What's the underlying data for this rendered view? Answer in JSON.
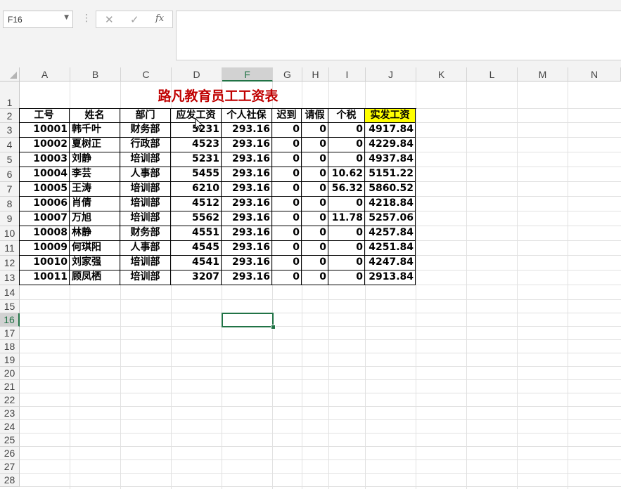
{
  "name_box": {
    "value": "F16"
  },
  "formula_bar": {
    "cancel_icon": "✕",
    "enter_icon": "✓",
    "fx_label": "fx",
    "content": ""
  },
  "columns": [
    "A",
    "B",
    "C",
    "D",
    "F",
    "G",
    "H",
    "I",
    "J",
    "K",
    "L",
    "M",
    "N"
  ],
  "active_column": "F",
  "rows": [
    "1",
    "2",
    "3",
    "4",
    "5",
    "6",
    "7",
    "8",
    "9",
    "10",
    "11",
    "12",
    "13",
    "14",
    "15",
    "16",
    "17",
    "18",
    "19",
    "20",
    "21",
    "22",
    "23",
    "24",
    "25",
    "26",
    "27",
    "28"
  ],
  "active_row": "16",
  "sheet": {
    "title": "路凡教育员工工资表",
    "headers": [
      "工号",
      "姓名",
      "部门",
      "应发工资",
      "个人社保",
      "迟到",
      "请假",
      "个税",
      "实发工资"
    ],
    "highlight_header_color": "#ffff00",
    "title_color": "#c00000",
    "data": [
      [
        "10001",
        "韩千叶",
        "财务部",
        "5231",
        "293.16",
        "0",
        "0",
        "0",
        "4917.84"
      ],
      [
        "10002",
        "夏树正",
        "行政部",
        "4523",
        "293.16",
        "0",
        "0",
        "0",
        "4229.84"
      ],
      [
        "10003",
        "刘静",
        "培训部",
        "5231",
        "293.16",
        "0",
        "0",
        "0",
        "4937.84"
      ],
      [
        "10004",
        "李芸",
        "人事部",
        "5455",
        "293.16",
        "0",
        "0",
        "10.62",
        "5151.22"
      ],
      [
        "10005",
        "王涛",
        "培训部",
        "6210",
        "293.16",
        "0",
        "0",
        "56.32",
        "5860.52"
      ],
      [
        "10006",
        "肖倩",
        "培训部",
        "4512",
        "293.16",
        "0",
        "0",
        "0",
        "4218.84"
      ],
      [
        "10007",
        "万旭",
        "培训部",
        "5562",
        "293.16",
        "0",
        "0",
        "11.78",
        "5257.06"
      ],
      [
        "10008",
        "林静",
        "财务部",
        "4551",
        "293.16",
        "0",
        "0",
        "0",
        "4257.84"
      ],
      [
        "10009",
        "何琪阳",
        "人事部",
        "4545",
        "293.16",
        "0",
        "0",
        "0",
        "4251.84"
      ],
      [
        "10010",
        "刘家强",
        "培训部",
        "4541",
        "293.16",
        "0",
        "0",
        "0",
        "4247.84"
      ],
      [
        "10011",
        "顾凤栖",
        "培训部",
        "3207",
        "293.16",
        "0",
        "0",
        "0",
        "2913.84"
      ]
    ]
  },
  "accent_color": "#217346"
}
